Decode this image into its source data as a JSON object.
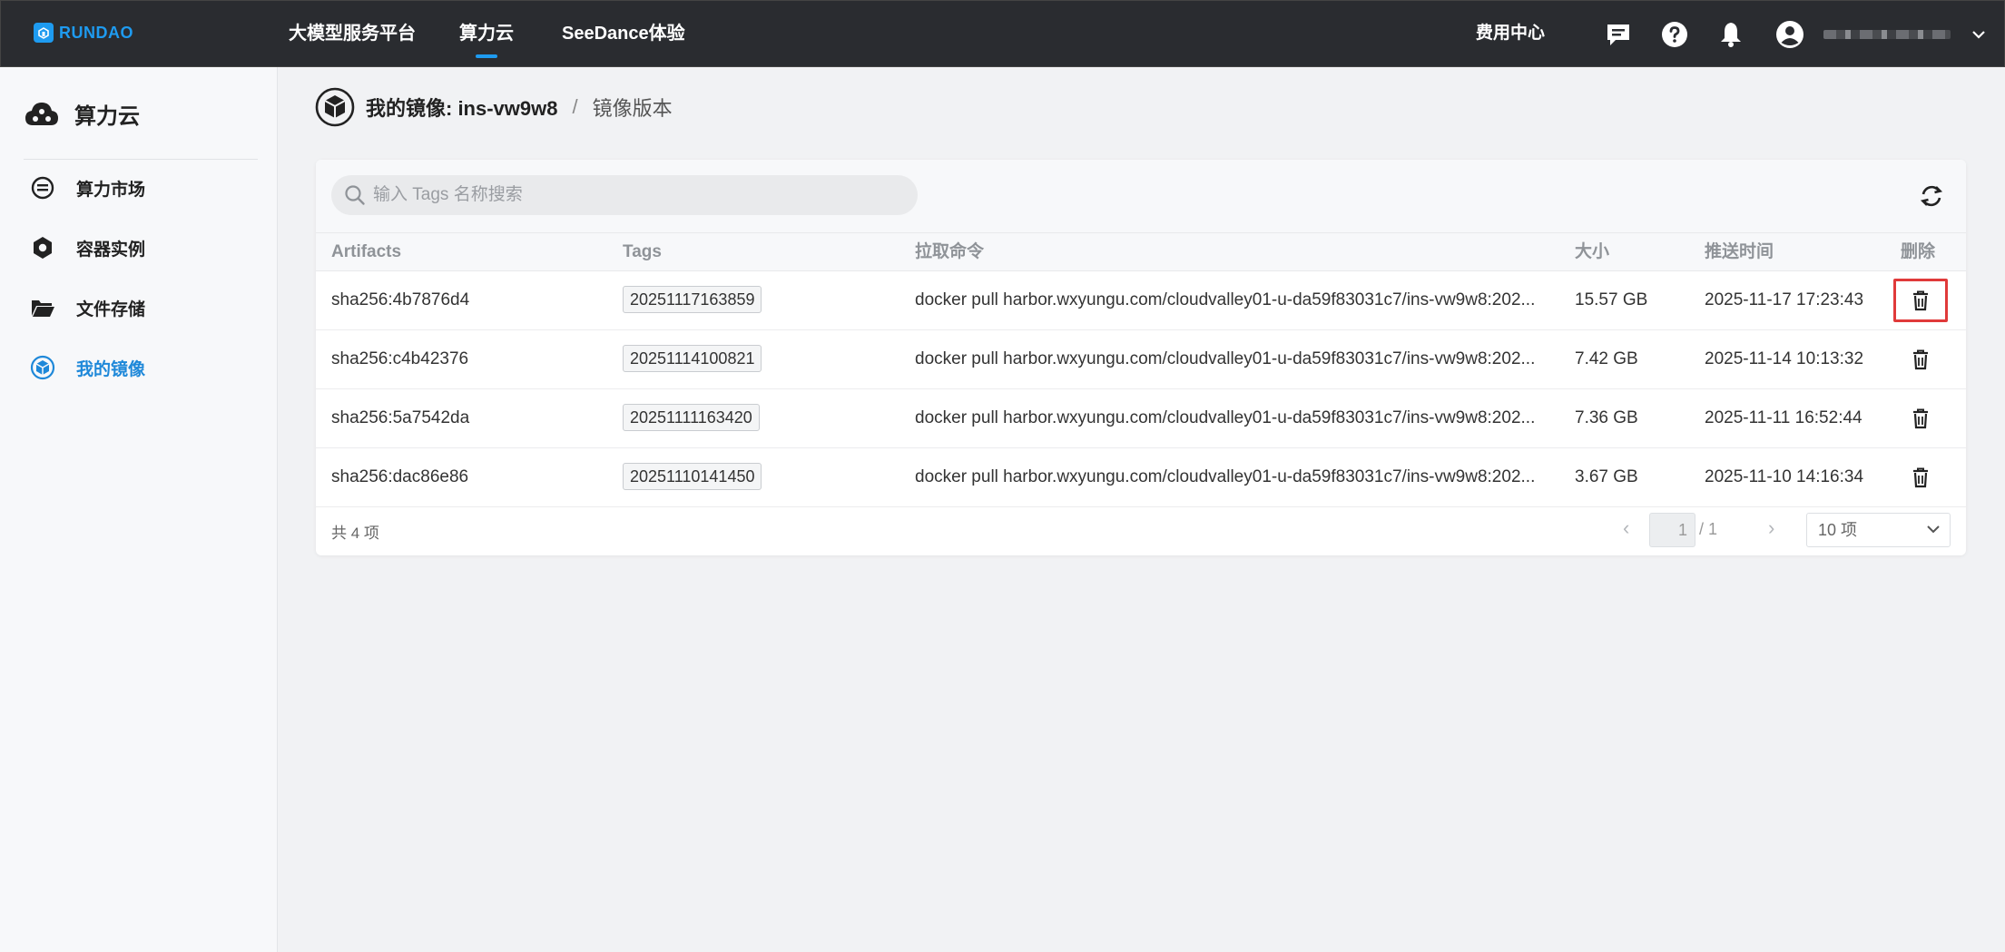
{
  "brand": {
    "name": "RUNDAO",
    "accent": "#1e9bf0"
  },
  "topnav": {
    "items": [
      {
        "label": "大模型服务平台",
        "active": false
      },
      {
        "label": "算力云",
        "active": true
      },
      {
        "label": "SeeDance体验",
        "active": false
      }
    ],
    "billing_label": "费用中心",
    "icons": [
      "message-icon",
      "help-icon",
      "bell-icon",
      "user-icon",
      "chevron-down-icon"
    ]
  },
  "sidebar": {
    "title": "算力云",
    "items": [
      {
        "label": "算力市场",
        "icon": "market-icon",
        "active": false
      },
      {
        "label": "容器实例",
        "icon": "container-icon",
        "active": false
      },
      {
        "label": "文件存储",
        "icon": "folder-icon",
        "active": false
      },
      {
        "label": "我的镜像",
        "icon": "image-icon",
        "active": true
      }
    ]
  },
  "breadcrumb": {
    "parent": "我的镜像: ins-vw9w8",
    "separator": "/",
    "current": "镜像版本"
  },
  "search": {
    "placeholder": "输入 Tags 名称搜索",
    "value": ""
  },
  "table": {
    "columns": [
      "Artifacts",
      "Tags",
      "拉取命令",
      "大小",
      "推送时间",
      "删除"
    ],
    "rows": [
      {
        "artifact": "sha256:4b7876d4",
        "tag": "20251117163859",
        "command": "docker pull harbor.wxyungu.com/cloudvalley01-u-da59f83031c7/ins-vw9w8:202...",
        "size": "15.57 GB",
        "pushed": "2025-11-17 17:23:43",
        "highlighted": true
      },
      {
        "artifact": "sha256:c4b42376",
        "tag": "20251114100821",
        "command": "docker pull harbor.wxyungu.com/cloudvalley01-u-da59f83031c7/ins-vw9w8:202...",
        "size": "7.42 GB",
        "pushed": "2025-11-14 10:13:32",
        "highlighted": false
      },
      {
        "artifact": "sha256:5a7542da",
        "tag": "20251111163420",
        "command": "docker pull harbor.wxyungu.com/cloudvalley01-u-da59f83031c7/ins-vw9w8:202...",
        "size": "7.36 GB",
        "pushed": "2025-11-11 16:52:44",
        "highlighted": false
      },
      {
        "artifact": "sha256:dac86e86",
        "tag": "20251110141450",
        "command": "docker pull harbor.wxyungu.com/cloudvalley01-u-da59f83031c7/ins-vw9w8:202...",
        "size": "3.67 GB",
        "pushed": "2025-11-10 14:16:34",
        "highlighted": false
      }
    ]
  },
  "pagination": {
    "total_label": "共 4 项",
    "current_page": "1",
    "total_pages": "/ 1",
    "page_size": "10 项",
    "prev": "‹",
    "next": "›"
  },
  "colors": {
    "highlight_border": "#e03a3a",
    "active_blue": "#1e88d9",
    "topbar_bg": "#2a2c30"
  }
}
